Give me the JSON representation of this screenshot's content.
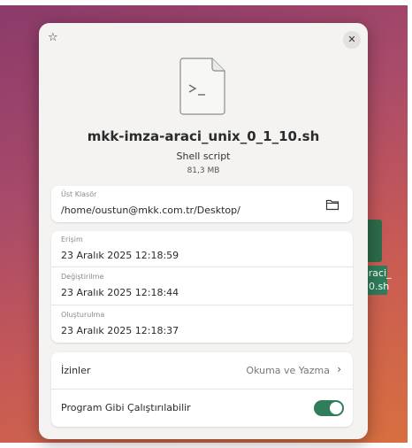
{
  "desktop": {
    "icon_label": "araci_ 10.sh"
  },
  "dialog": {
    "star_glyph": "☆",
    "close_glyph": "✕",
    "file_icon_symbol": "&gt;_",
    "file_name": "mkk-imza-araci_unix_0_1_10.sh",
    "file_type": "Shell script",
    "file_size": "81,3 MB",
    "location": {
      "caption": "Üst Klasör",
      "path": "/home/oustun@mkk.com.tr/Desktop/"
    },
    "times": [
      {
        "caption": "Erişim",
        "value": "23 Aralık 2025 12:18:59"
      },
      {
        "caption": "Değiştirilme",
        "value": "23 Aralık 2025 12:18:44"
      },
      {
        "caption": "Oluşturulma",
        "value": "23 Aralık 2025 12:18:37"
      }
    ],
    "permissions": {
      "label": "İzinler",
      "value": "Okuma ve Yazma",
      "chevron": "›"
    },
    "executable": {
      "label": "Program Gibi Çalıştırılabilir",
      "on": true
    }
  },
  "colors": {
    "accent": "#2f7d5a",
    "dialog_bg": "#f4f3f2",
    "card_bg": "#ffffff"
  }
}
